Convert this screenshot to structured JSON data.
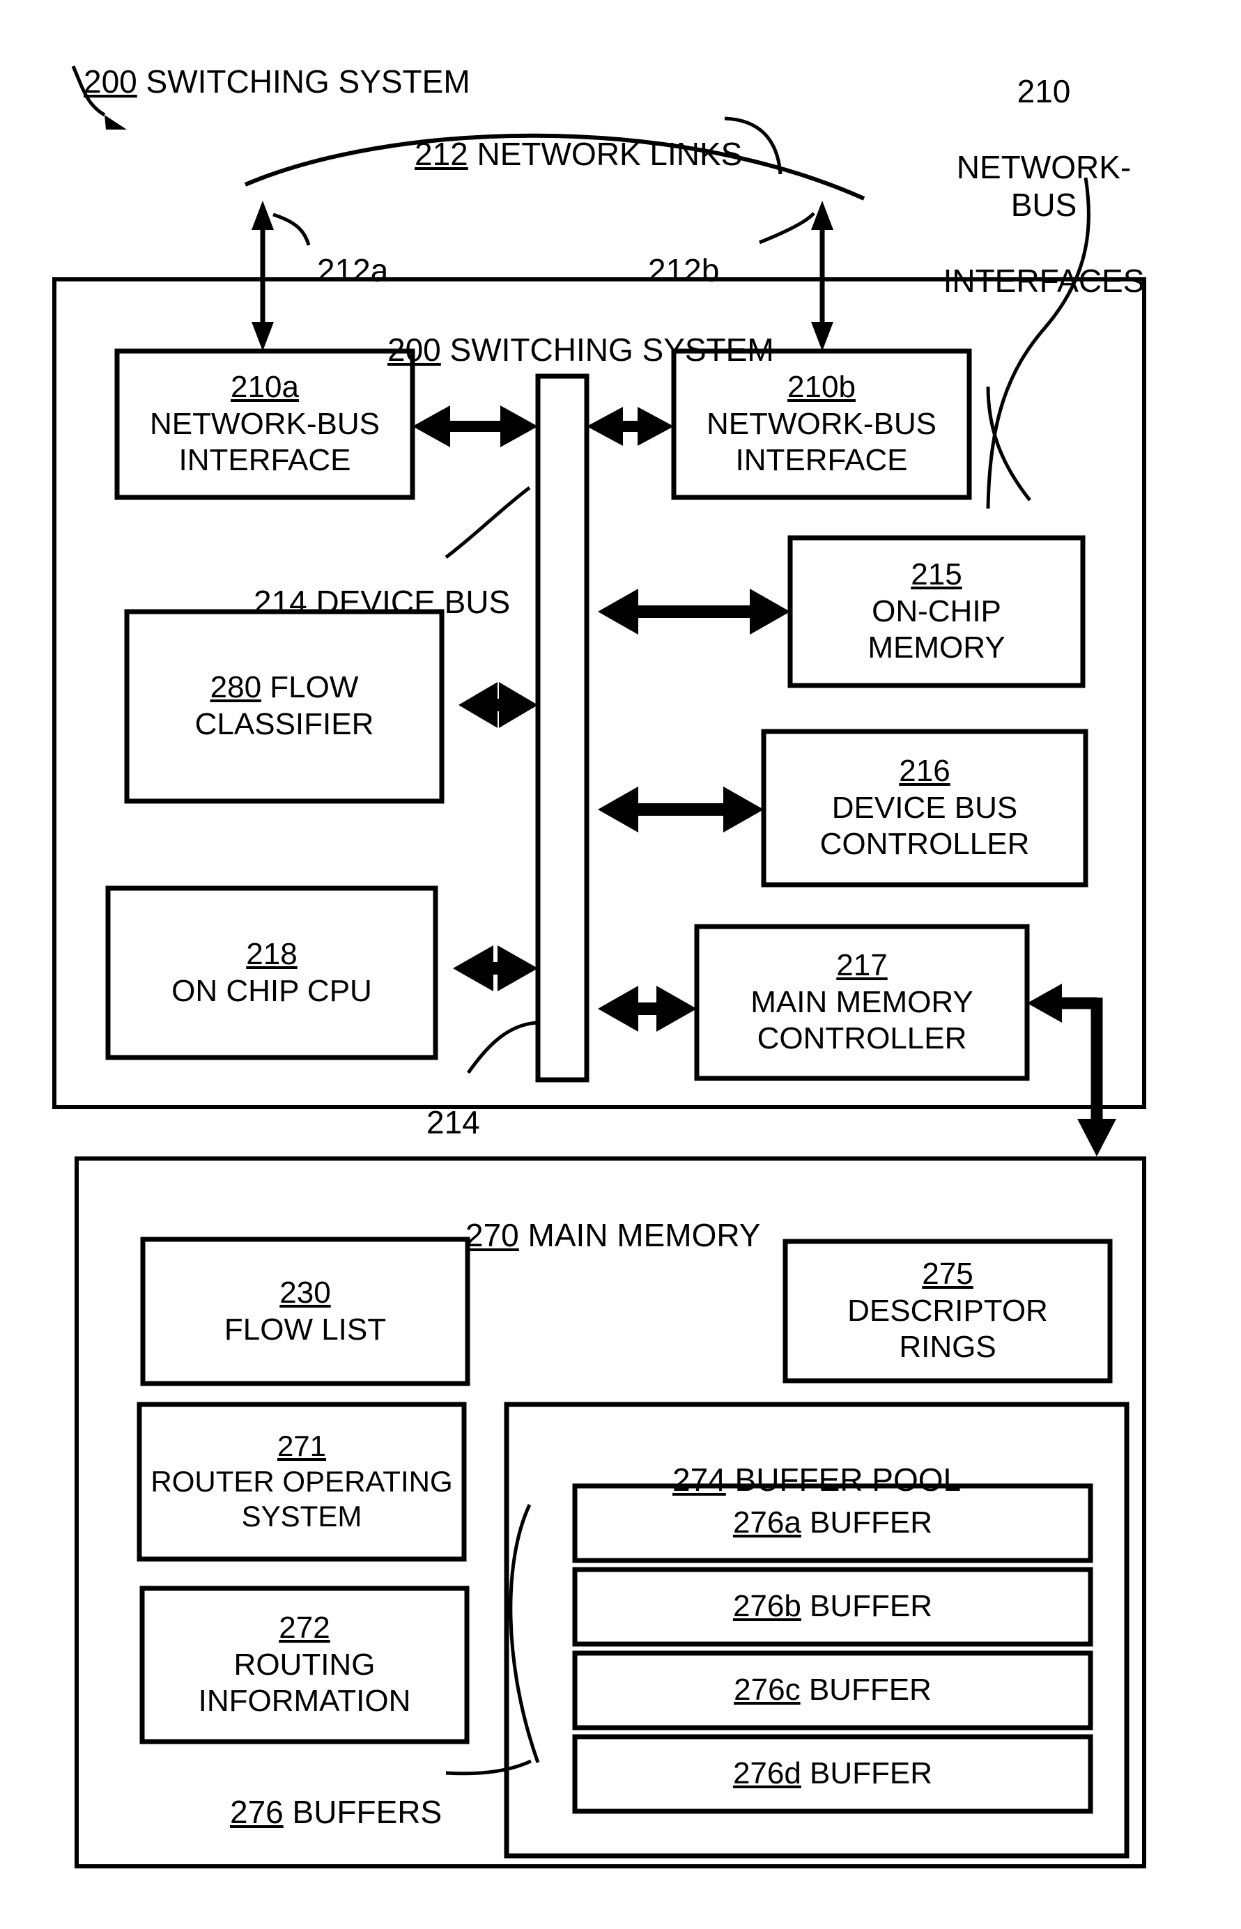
{
  "figure": {
    "title_outer": "200 SWITCHING SYSTEM",
    "title_outer_ref": "200",
    "title_outer_rest": " SWITCHING SYSTEM"
  },
  "callouts": {
    "system_top_left": {
      "ref": "200",
      "text": " SWITCHING SYSTEM"
    },
    "network_links": {
      "ref": "212",
      "text": " NETWORK LINKS"
    },
    "network_bus_interfaces": {
      "ref": "210",
      "line1": "210",
      "line2": "NETWORK-BUS",
      "line3": "INTERFACES"
    },
    "link_a": "212a",
    "link_b": "212b",
    "device_bus": {
      "ref": "214",
      "text": " DEVICE BUS"
    },
    "device_bus_short": "214",
    "buffers": {
      "ref": "276",
      "text": " BUFFERS"
    }
  },
  "switching_system": {
    "header": {
      "ref": "200",
      "rest": " SWITCHING SYSTEM"
    },
    "blocks": [
      {
        "id": "nbi-a",
        "ref": "210a",
        "lines": [
          "NETWORK-BUS",
          "INTERFACE"
        ]
      },
      {
        "id": "nbi-b",
        "ref": "210b",
        "lines": [
          "NETWORK-BUS",
          "INTERFACE"
        ]
      },
      {
        "id": "onchip-memory",
        "ref": "215",
        "lines": [
          "ON-CHIP",
          "MEMORY"
        ]
      },
      {
        "id": "flow-classifier",
        "ref": "280",
        "inline": " FLOW",
        "lines": [
          "CLASSIFIER"
        ]
      },
      {
        "id": "device-bus-controller",
        "ref": "216",
        "lines": [
          "DEVICE BUS",
          "CONTROLLER"
        ]
      },
      {
        "id": "on-chip-cpu",
        "ref": "218",
        "lines": [
          "ON CHIP CPU"
        ]
      },
      {
        "id": "main-memory-controller",
        "ref": "217",
        "lines": [
          "MAIN MEMORY",
          "CONTROLLER"
        ]
      }
    ]
  },
  "main_memory": {
    "header": {
      "ref": "270",
      "rest": " MAIN MEMORY"
    },
    "blocks": [
      {
        "id": "flow-list",
        "ref": "230",
        "lines": [
          "FLOW LIST"
        ]
      },
      {
        "id": "descriptor-rings",
        "ref": "275",
        "lines": [
          "DESCRIPTOR",
          "RINGS"
        ]
      },
      {
        "id": "router-operating-system",
        "ref": "271",
        "lines": [
          "ROUTER OPERATING",
          "SYSTEM"
        ]
      },
      {
        "id": "routing-information",
        "ref": "272",
        "lines": [
          "ROUTING",
          "INFORMATION"
        ]
      }
    ],
    "buffer_pool": {
      "header": {
        "ref": "274",
        "rest": " BUFFER POOL"
      },
      "buffers": [
        {
          "ref": "276a",
          "rest": " BUFFER"
        },
        {
          "ref": "276b",
          "rest": " BUFFER"
        },
        {
          "ref": "276c",
          "rest": " BUFFER"
        },
        {
          "ref": "276d",
          "rest": " BUFFER"
        }
      ]
    }
  },
  "colors": {
    "ink": "#000000",
    "paper": "#ffffff"
  }
}
